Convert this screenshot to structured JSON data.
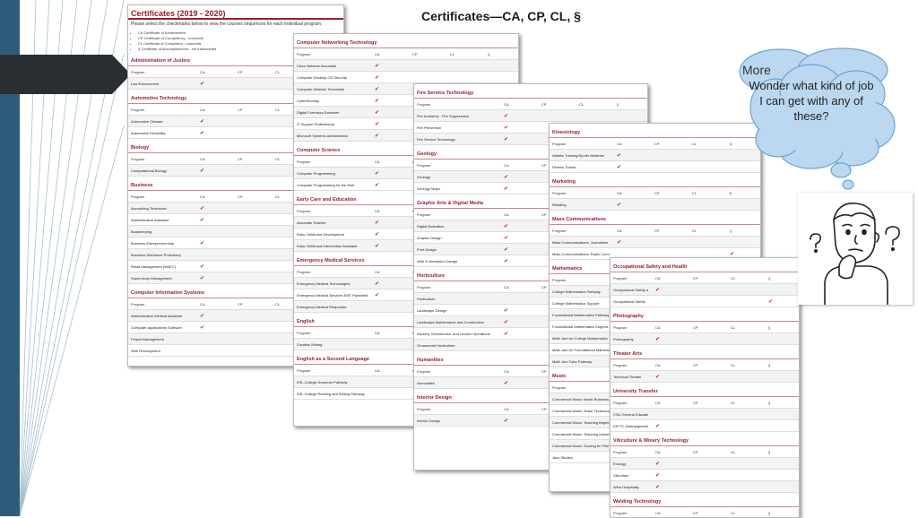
{
  "slide": {
    "title": "Certificates—CA, CP, CL, §"
  },
  "cloud": {
    "back_text": "More",
    "thought": "Wonder what kind of job I can get with any of these?"
  },
  "headers": [
    "Program",
    "CA",
    "CP",
    "CL",
    "§"
  ],
  "sheets": [
    {
      "id": "sheet-1",
      "header": "Certificates (2019 - 2020)",
      "subheader": "Please select the checkmarks below to view the courses sequences for each individual program.",
      "legend": [
        "CA Certificate of Achievement",
        "CP Certificate of Competency - noncredit",
        "CL Certificate of Completion - noncredit",
        "§ Certificate of Accomplishment - not transcripted"
      ],
      "sections": [
        {
          "title": "Administration of Justice",
          "rows": [
            [
              "Law Enforcement",
              "✔",
              "",
              "",
              ""
            ]
          ]
        },
        {
          "title": "Automotive Technology",
          "rows": [
            [
              "Automotive Chassis",
              "✔",
              "",
              "",
              ""
            ],
            [
              "Automotive Drivability",
              "✔",
              "",
              "",
              ""
            ]
          ]
        },
        {
          "title": "Biology",
          "rows": [
            [
              "Computational Biology",
              "✔",
              "",
              "",
              ""
            ]
          ]
        },
        {
          "title": "Business",
          "rows": [
            [
              "Accounting Technician",
              "✔",
              "",
              "",
              ""
            ],
            [
              "Administrative Assistant",
              "✔",
              "",
              "",
              ""
            ],
            [
              "Bookkeeping",
              "",
              "",
              "",
              ""
            ],
            [
              "Business Entrepreneurship",
              "✔",
              "",
              "",
              ""
            ],
            [
              "Business Workforce Proficiency",
              "",
              "",
              "",
              ""
            ],
            [
              "Retail Management (WAFC)",
              "✔",
              "",
              "",
              ""
            ],
            [
              "Supervisory Management",
              "✔",
              "",
              "",
              ""
            ]
          ]
        },
        {
          "title": "Computer Information Systems",
          "rows": [
            [
              "Administrative Medical Assistant",
              "✔",
              "",
              "",
              ""
            ],
            [
              "Computer Applications Software",
              "✔",
              "",
              "",
              ""
            ],
            [
              "Project Management",
              "",
              "",
              "",
              ""
            ],
            [
              "Web Development",
              "",
              "",
              "",
              ""
            ]
          ]
        }
      ]
    },
    {
      "id": "sheet-2",
      "sections": [
        {
          "title": "Computer Networking Technology",
          "rows": [
            [
              "Cisco Network Associate",
              "✔",
              "",
              "",
              ""
            ],
            [
              "Computer Desktop OS Security",
              "✔",
              "",
              "",
              ""
            ],
            [
              "Computer Network Technician",
              "✔",
              "",
              "",
              ""
            ],
            [
              "CyberSecurity",
              "✔",
              "",
              "",
              ""
            ],
            [
              "Digital Forensics Examiner",
              "✔",
              "",
              "",
              ""
            ],
            [
              "IT Support Professional",
              "✔",
              "",
              "",
              ""
            ],
            [
              "Microsoft Systems Administrator",
              "✔",
              "",
              "",
              ""
            ]
          ]
        },
        {
          "title": "Computer Science",
          "rows": [
            [
              "Computer Programming",
              "✔",
              "",
              "",
              ""
            ],
            [
              "Computer Programming for the Web",
              "✔",
              "",
              "",
              ""
            ]
          ]
        },
        {
          "title": "Early Care and Education",
          "rows": [
            [
              "Associate Teacher",
              "✔",
              "",
              "",
              ""
            ],
            [
              "Early Childhood Development",
              "✔",
              "",
              "",
              ""
            ],
            [
              "Early Childhood Intervention Assistant",
              "✔",
              "",
              "",
              ""
            ]
          ]
        },
        {
          "title": "Emergency Medical Services",
          "rows": [
            [
              "Emergency Medical Technologies",
              "✔",
              "",
              "",
              ""
            ],
            [
              "Emergency Medical Services EMT Paramedic",
              "✔",
              "",
              "",
              ""
            ],
            [
              "Emergency Medical Responder",
              "",
              "",
              "",
              ""
            ]
          ]
        },
        {
          "title": "English",
          "rows": [
            [
              "Creative Writing",
              "",
              "",
              "",
              ""
            ]
          ]
        },
        {
          "title": "English as a Second Language",
          "rows": [
            [
              "ESL College Grammar Pathway",
              "",
              "",
              "",
              ""
            ],
            [
              "ESL College Reading and Writing Pathway",
              "",
              "",
              "",
              ""
            ]
          ]
        }
      ]
    },
    {
      "id": "sheet-3",
      "sections": [
        {
          "title": "Fire Service Technology",
          "rows": [
            [
              "Fire Academy - Fire Suppression",
              "✔",
              "",
              "",
              ""
            ],
            [
              "Fire Prevention",
              "✔",
              "",
              "",
              ""
            ],
            [
              "Fire Service Technology",
              "✔",
              "",
              "",
              ""
            ]
          ]
        },
        {
          "title": "Geology",
          "rows": [
            [
              "Geology",
              "✔",
              "",
              "",
              ""
            ],
            [
              "Geology Major",
              "✔",
              "",
              "",
              ""
            ]
          ]
        },
        {
          "title": "Graphic Arts & Digital Media",
          "rows": [
            [
              "Digital Illustration",
              "✔",
              "",
              "",
              ""
            ],
            [
              "Graphic Design",
              "✔",
              "",
              "",
              ""
            ],
            [
              "Print Design",
              "✔",
              "",
              "",
              ""
            ],
            [
              "Web & Interaction Design",
              "✔",
              "",
              "",
              ""
            ]
          ]
        },
        {
          "title": "Horticulture",
          "rows": [
            [
              "Horticulture",
              "",
              "",
              "",
              ""
            ],
            [
              "Landscape Design",
              "✔",
              "",
              "",
              ""
            ],
            [
              "Landscape Maintenance and Construction",
              "✔",
              "",
              "",
              ""
            ],
            [
              "Nursery, Greenhouse, and Grower Operations",
              "✔",
              "",
              "",
              ""
            ],
            [
              "Ornamental Horticulture",
              "",
              "",
              "",
              ""
            ]
          ]
        },
        {
          "title": "Humanities",
          "rows": [
            [
              "Humanities",
              "✔",
              "",
              "",
              ""
            ]
          ]
        },
        {
          "title": "Interior Design",
          "rows": [
            [
              "Interior Design",
              "✔",
              "",
              "",
              ""
            ]
          ]
        }
      ]
    },
    {
      "id": "sheet-4",
      "sections": [
        {
          "title": "Kinesiology",
          "rows": [
            [
              "Athletic Training/Sports Medicine",
              "✔",
              "",
              "",
              ""
            ],
            [
              "Fitness Trainer",
              "✔",
              "",
              "",
              ""
            ]
          ]
        },
        {
          "title": "Marketing",
          "rows": [
            [
              "Retailing",
              "✔",
              "",
              "",
              ""
            ]
          ]
        },
        {
          "title": "Mass Communications",
          "rows": [
            [
              "Mass Communications: Journalism",
              "✔",
              "",
              "",
              ""
            ],
            [
              "Mass Communications: Radio Communications",
              "",
              "",
              "",
              "✔"
            ]
          ]
        },
        {
          "title": "Mathematics",
          "rows": [
            [
              "College Mathematics Pathway",
              "",
              "",
              "",
              ""
            ],
            [
              "College Mathematics Support",
              "",
              "",
              "",
              ""
            ],
            [
              "Foundational Mathematics Pathway",
              "",
              "",
              "",
              ""
            ],
            [
              "Foundational Mathematics Support",
              "",
              "",
              "",
              ""
            ],
            [
              "Math Jam for College Mathematics",
              "",
              "",
              "",
              ""
            ],
            [
              "Math Jam for Foundational Mathematics",
              "",
              "",
              "",
              ""
            ],
            [
              "Math Jam Tutor Pathway",
              "",
              "",
              "",
              ""
            ]
          ]
        },
        {
          "title": "Music",
          "rows": [
            [
              "Commercial Music: Music Business",
              "✔",
              "",
              "",
              ""
            ],
            [
              "Commercial Music: Music Technology Fundamentals",
              "✔",
              "",
              "",
              ""
            ],
            [
              "Commercial Music: Teaching Beginning",
              "",
              "",
              "",
              ""
            ],
            [
              "Commercial Music: Teaching Intermediate Piano",
              "",
              "",
              "",
              ""
            ],
            [
              "Commercial Music: Scoring for Film and Multimedia",
              "",
              "",
              "",
              ""
            ],
            [
              "Jazz Studies",
              "",
              "",
              "",
              ""
            ]
          ]
        }
      ]
    },
    {
      "id": "sheet-5",
      "sections": [
        {
          "title": "Occupational Safety and Health",
          "rows": [
            [
              "Occupational Safety and Health",
              "✔",
              "",
              "",
              ""
            ],
            [
              "Occupational Safety",
              "",
              "",
              "",
              "✔"
            ]
          ]
        },
        {
          "title": "Photography",
          "rows": [
            [
              "Photography",
              "✔",
              "",
              "",
              ""
            ]
          ]
        },
        {
          "title": "Theater Arts",
          "rows": [
            [
              "Technical Theater",
              "✔",
              "",
              "",
              ""
            ]
          ]
        },
        {
          "title": "University Transfer",
          "rows": [
            [
              "CSU General Education Breadth",
              "",
              "",
              "",
              ""
            ],
            [
              "IGETC (Intersegmental General Education Curriculum)",
              "✔",
              "",
              "",
              ""
            ]
          ]
        },
        {
          "title": "Viticulture & Winery Technology",
          "rows": [
            [
              "Enology",
              "✔",
              "",
              "",
              ""
            ],
            [
              "Viticulture",
              "✔",
              "",
              "",
              ""
            ],
            [
              "Wine Hospitality",
              "✔",
              "",
              "",
              ""
            ]
          ]
        },
        {
          "title": "Welding Technology",
          "rows": [
            [
              "Welding Technology",
              "✔",
              "",
              "",
              ""
            ]
          ]
        }
      ]
    }
  ]
}
